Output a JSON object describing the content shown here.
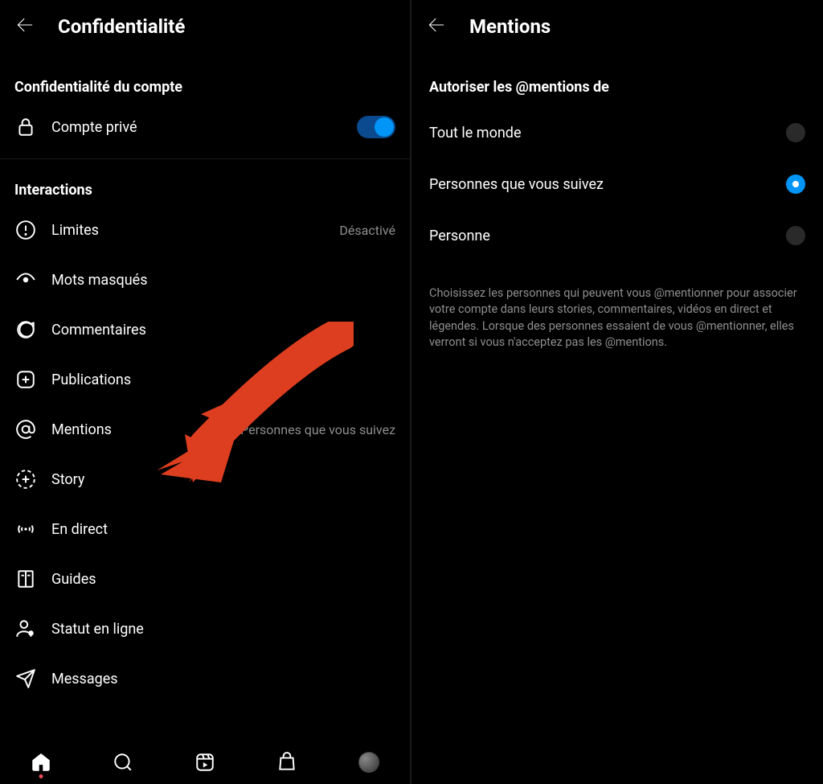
{
  "left": {
    "title": "Confidentialité",
    "section_account": "Confidentialité du compte",
    "private_account_label": "Compte privé",
    "private_account_on": true,
    "section_interactions": "Interactions",
    "items": [
      {
        "label": "Limites",
        "value": "Désactivé"
      },
      {
        "label": "Mots masqués",
        "value": ""
      },
      {
        "label": "Commentaires",
        "value": ""
      },
      {
        "label": "Publications",
        "value": ""
      },
      {
        "label": "Mentions",
        "value": "Personnes que vous suivez"
      },
      {
        "label": "Story",
        "value": ""
      },
      {
        "label": "En direct",
        "value": ""
      },
      {
        "label": "Guides",
        "value": ""
      },
      {
        "label": "Statut en ligne",
        "value": ""
      },
      {
        "label": "Messages",
        "value": ""
      }
    ]
  },
  "right": {
    "title": "Mentions",
    "section": "Autoriser les @mentions de",
    "options": [
      {
        "label": "Tout le monde",
        "selected": false
      },
      {
        "label": "Personnes que vous suivez",
        "selected": true
      },
      {
        "label": "Personne",
        "selected": false
      }
    ],
    "description": "Choisissez les personnes qui peuvent vous @mentionner pour associer votre compte dans leurs stories, commentaires, vidéos en direct et légendes. Lorsque des personnes essaient de vous @mentionner, elles verront si vous n'acceptez pas les @mentions."
  }
}
